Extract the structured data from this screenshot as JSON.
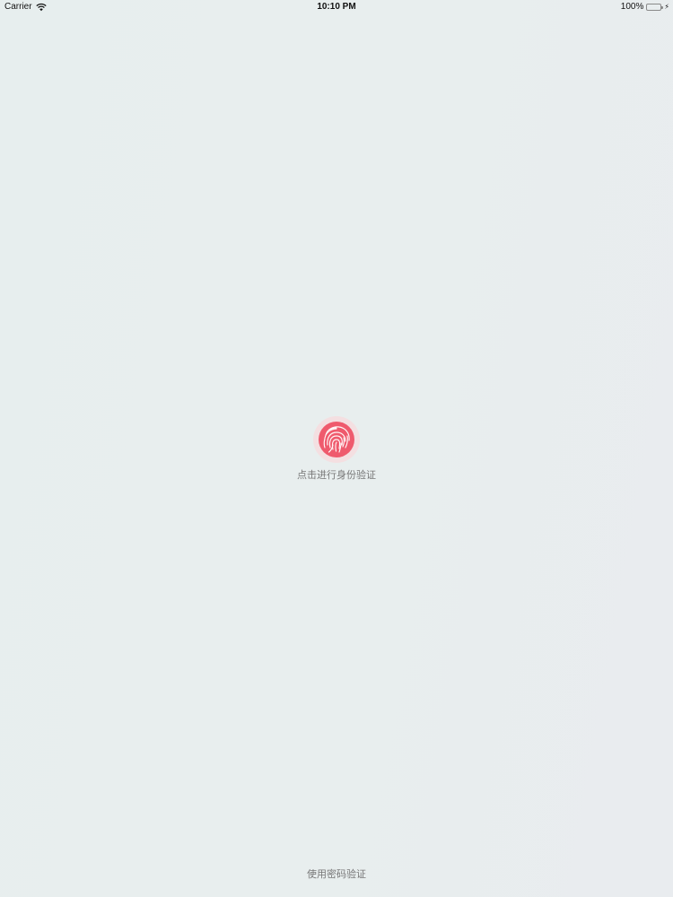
{
  "status_bar": {
    "carrier": "Carrier",
    "time": "10:10 PM",
    "battery": "100%",
    "charging_icon": "⚡"
  },
  "auth": {
    "icon": "fingerprint-icon",
    "prompt": "点击进行身份验证",
    "password_option": "使用密码验证"
  },
  "colors": {
    "background": "#e8eeee",
    "accent": "#e84a5f",
    "ring": "#f4dfe1",
    "secondary_text": "#777777",
    "battery_fill": "#4cd964"
  }
}
